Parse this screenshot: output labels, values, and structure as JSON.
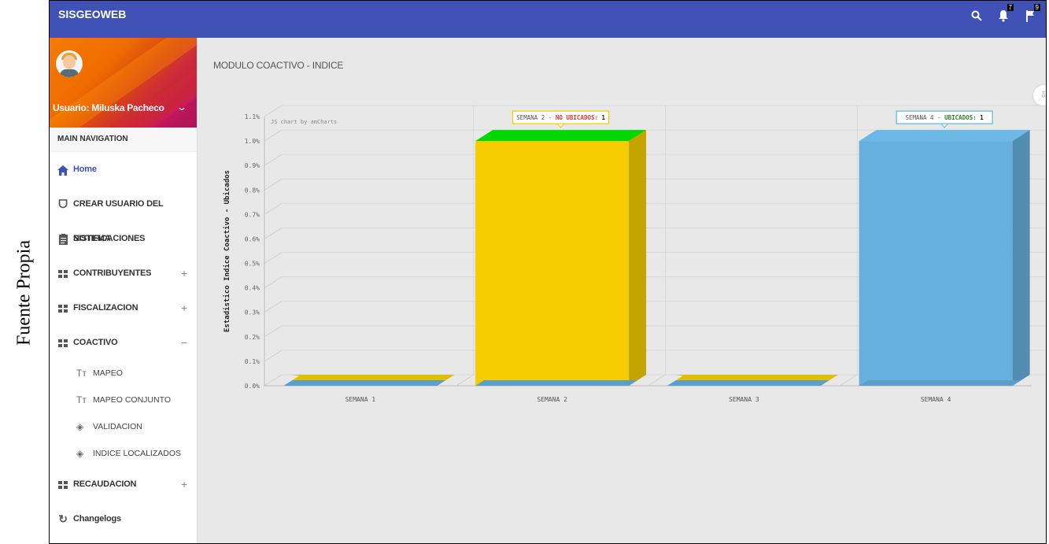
{
  "caption": "Fuente Propia",
  "topbar": {
    "brand": "SISGEOWEB",
    "notifications_count": "7",
    "flags_count": "9",
    "icons": [
      "search-icon",
      "bell-icon",
      "flag-icon"
    ]
  },
  "sidebar": {
    "user_label": "Usuario: Miluska Pacheco",
    "nav_header": "MAIN NAVIGATION",
    "items": [
      {
        "label": "Home",
        "icon": "home-icon"
      },
      {
        "label": "CREAR USUARIO DEL SISTEMA",
        "icon": "users-icon"
      },
      {
        "label": "NOTIFICACIONES",
        "icon": "clipboard-icon"
      },
      {
        "label": "CONTRIBUYENTES",
        "icon": "widgets-icon",
        "toggle": "+"
      },
      {
        "label": "FISCALIZACION",
        "icon": "widgets-icon",
        "toggle": "+"
      },
      {
        "label": "COACTIVO",
        "icon": "widgets-icon",
        "toggle": "−"
      }
    ],
    "subitems": [
      {
        "label": "MAPEO",
        "icon": "text-icon"
      },
      {
        "label": "MAPEO CONJUNTO",
        "icon": "text-icon"
      },
      {
        "label": "VALIDACION",
        "icon": "layers-icon"
      },
      {
        "label": "INDICE LOCALIZADOS",
        "icon": "layers-icon"
      }
    ],
    "items_after": [
      {
        "label": "RECAUDACION",
        "icon": "widgets-icon",
        "toggle": "+"
      },
      {
        "label": "Changelogs",
        "icon": "history-icon"
      }
    ]
  },
  "main": {
    "title": "MODULO COACTIVO - INDICE"
  },
  "chart_data": {
    "type": "bar",
    "credit": "JS chart by amCharts",
    "ylabel": "Estadistico Indice Coactivo - Ubicados",
    "xlabel": "",
    "ylim": [
      0,
      1.1
    ],
    "yticks": [
      "0.0%",
      "0.1%",
      "0.2%",
      "0.3%",
      "0.4%",
      "0.5%",
      "0.6%",
      "0.7%",
      "0.8%",
      "0.9%",
      "1.0%",
      "1.1%"
    ],
    "categories": [
      "SEMANA 1",
      "SEMANA 2",
      "SEMANA 3",
      "SEMANA 4"
    ],
    "series": [
      {
        "name": "NO UBICADOS",
        "color": "#f5cd00",
        "values": [
          0,
          1,
          0,
          0
        ]
      },
      {
        "name": "UBICADOS",
        "color": "#67b0dd",
        "values": [
          0,
          0,
          0,
          1
        ]
      }
    ],
    "balloons": [
      {
        "week": "SEMANA 2",
        "name": "NO UBICADOS",
        "value": "1",
        "color": "#e53935"
      },
      {
        "week": "SEMANA 4",
        "name": "UBICADOS",
        "value": "1",
        "color": "#2e7d32"
      }
    ]
  }
}
